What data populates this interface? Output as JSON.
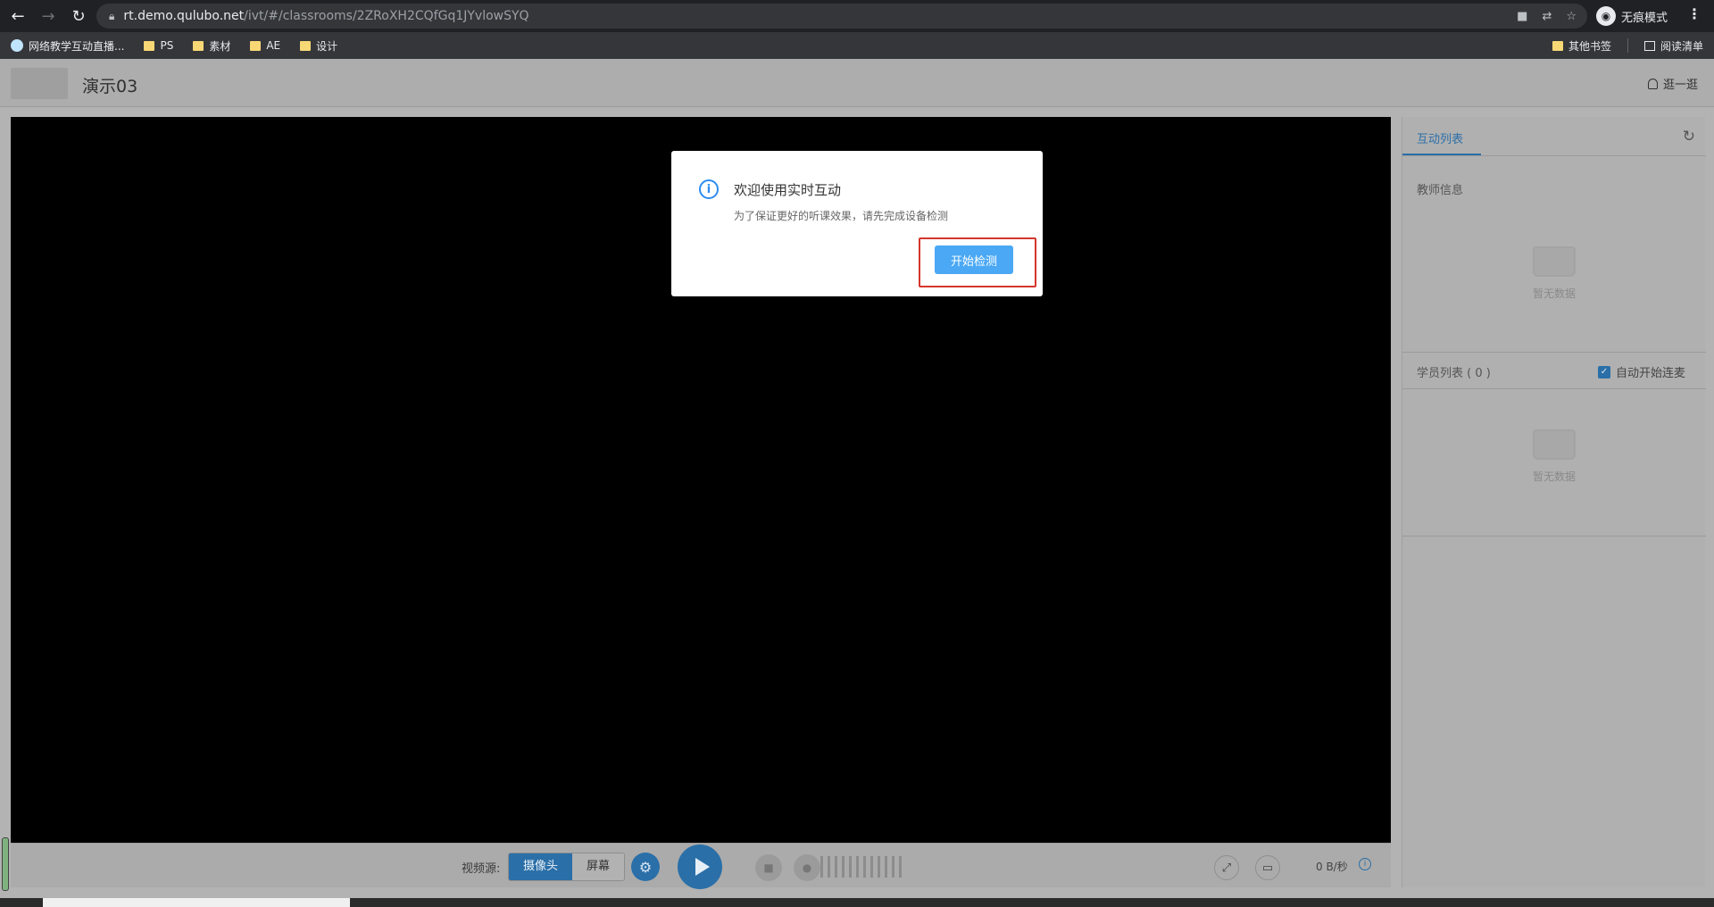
{
  "browser": {
    "url_host": "rt.demo.qulubo.net",
    "url_path": "/ivt/#/classrooms/2ZRoXH2CQfGq1JYvlowSYQ",
    "incognito_label": "无痕模式",
    "bookmarks": [
      {
        "label": "网络教学互动直播...",
        "icon": "cloud-icon"
      },
      {
        "label": "PS",
        "icon": "folder-icon"
      },
      {
        "label": "素材",
        "icon": "folder-icon"
      },
      {
        "label": "AE",
        "icon": "folder-icon"
      },
      {
        "label": "设计",
        "icon": "folder-icon"
      }
    ],
    "other_bookmarks": "其他书签",
    "reading_list": "阅读清单"
  },
  "header": {
    "title": "演示03",
    "user": "逛一逛"
  },
  "toolbar": {
    "source_label": "视频源:",
    "camera": "摄像头",
    "screen": "屏幕",
    "rate": "0 B/秒"
  },
  "panel": {
    "tab": "互动列表",
    "teacher_section": "教师信息",
    "empty_text": "暂无数据",
    "students_section": "学员列表 ( 0 )",
    "auto_connect": "自动开始连麦"
  },
  "dialog": {
    "title": "欢迎使用实时互动",
    "message": "为了保证更好的听课效果，请先完成设备检测",
    "button": "开始检测"
  },
  "colors": {
    "accent": "#2d8cf0",
    "highlight": "#d5362c"
  }
}
